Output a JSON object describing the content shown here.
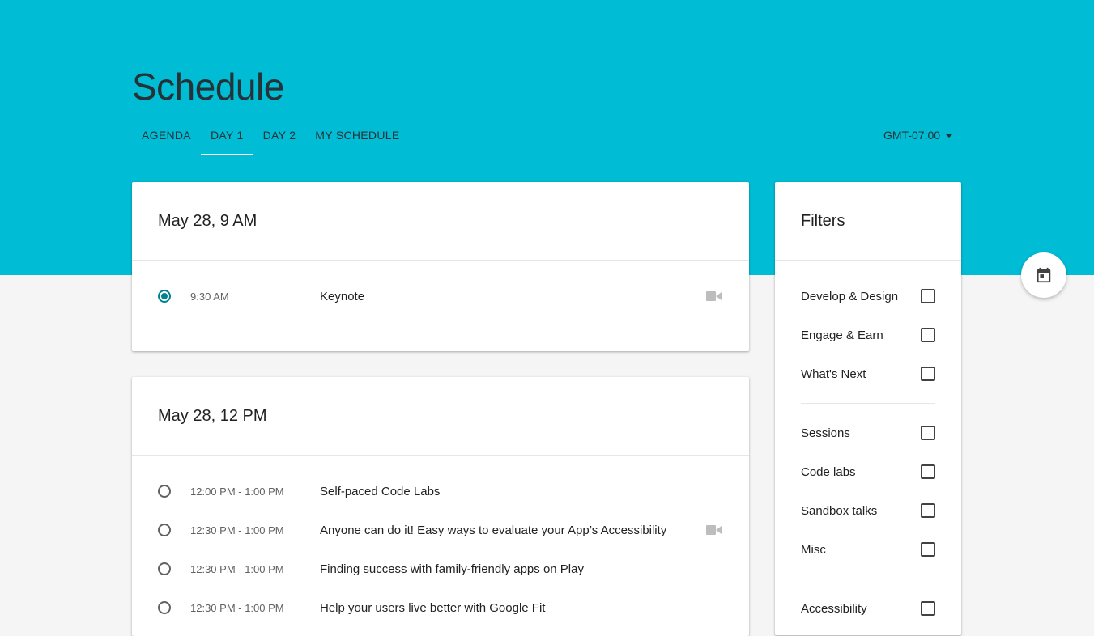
{
  "header": {
    "title": "Schedule",
    "tabs": [
      {
        "label": "AGENDA",
        "active": false
      },
      {
        "label": "DAY 1",
        "active": true
      },
      {
        "label": "DAY 2",
        "active": false
      },
      {
        "label": "MY SCHEDULE",
        "active": false
      }
    ],
    "timezone": "GMT-07:00"
  },
  "blocks": [
    {
      "heading": "May 28, 9 AM",
      "sessions": [
        {
          "time": "9:30 AM",
          "title": "Keynote",
          "selected": true,
          "video": true
        }
      ]
    },
    {
      "heading": "May 28, 12 PM",
      "sessions": [
        {
          "time": "12:00 PM - 1:00 PM",
          "title": "Self-paced Code Labs",
          "selected": false,
          "video": false
        },
        {
          "time": "12:30 PM - 1:00 PM",
          "title": "Anyone can do it! Easy ways to evaluate your App’s Accessibility",
          "selected": false,
          "video": true
        },
        {
          "time": "12:30 PM - 1:00 PM",
          "title": "Finding success with family-friendly apps on Play",
          "selected": false,
          "video": false
        },
        {
          "time": "12:30 PM - 1:00 PM",
          "title": "Help your users live better with Google Fit",
          "selected": false,
          "video": false
        }
      ]
    }
  ],
  "filters": {
    "title": "Filters",
    "groups": [
      [
        "Develop & Design",
        "Engage & Earn",
        "What's Next"
      ],
      [
        "Sessions",
        "Code labs",
        "Sandbox talks",
        "Misc"
      ],
      [
        "Accessibility"
      ]
    ]
  },
  "fab": {
    "icon": "calendar-icon"
  },
  "colors": {
    "accent": "#00bcd4",
    "radio": "#00838f",
    "background": "#f5f5f5"
  }
}
